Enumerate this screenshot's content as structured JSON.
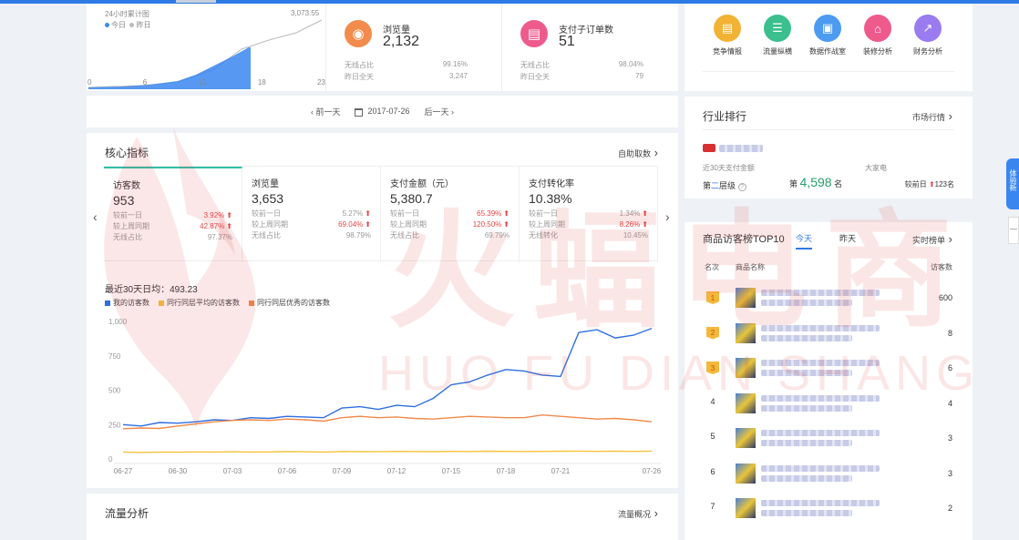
{
  "summary": {
    "mini_chart": {
      "title": "24小时累计图",
      "legend_today": "今日",
      "legend_yesterday": "昨日",
      "peak_label": "3,073.55",
      "x_ticks": [
        "0",
        "6",
        "12",
        "18",
        "23"
      ],
      "colors": {
        "today": "#3a86f0",
        "yesterday": "#bbbbbb"
      }
    },
    "views": {
      "title": "浏览量",
      "value": "2,132",
      "wireless_label": "无线占比",
      "wireless_value": "99.16%",
      "yday_label": "昨日全天",
      "yday_value": "3,247",
      "icon": "eye-icon",
      "color": "#f28b4b"
    },
    "orders": {
      "title": "支付子订单数",
      "value": "51",
      "wireless_label": "无线占比",
      "wireless_value": "98.04%",
      "yday_label": "昨日全天",
      "yday_value": "79",
      "icon": "clipboard-icon",
      "color": "#ef5a8c"
    }
  },
  "date_nav": {
    "prev": "‹ 前一天",
    "date": "2017-07-26",
    "next": "后一天 ›"
  },
  "core": {
    "title": "核心指标",
    "link": "自助取数",
    "tabs": [
      {
        "title": "访客数",
        "value": "953",
        "rows": [
          [
            "较前一日",
            "3.92%"
          ],
          [
            "较上周同期",
            "42.87%"
          ],
          [
            "无线占比",
            "97.37%"
          ]
        ],
        "up": [
          true,
          true,
          false
        ]
      },
      {
        "title": "浏览量",
        "value": "3,653",
        "rows": [
          [
            "较前一日",
            "5.27%"
          ],
          [
            "较上周同期",
            "69.04%"
          ],
          [
            "无线占比",
            "98.79%"
          ]
        ],
        "up": [
          true,
          true,
          false
        ]
      },
      {
        "title": "支付金额（元）",
        "value": "5,380.7",
        "rows": [
          [
            "较前一日",
            "65.39%"
          ],
          [
            "较上周同期",
            "120.50%"
          ],
          [
            "无线占比",
            "69.79%"
          ]
        ],
        "up": [
          true,
          true,
          false
        ]
      },
      {
        "title": "支付转化率",
        "value": "10.38%",
        "rows": [
          [
            "较前一日",
            "1.34%"
          ],
          [
            "较上周同期",
            "8.26%"
          ],
          [
            "无线转化",
            "10.45%"
          ]
        ],
        "up": [
          true,
          true,
          false
        ]
      }
    ],
    "avg_label": "最近30天日均：493.23"
  },
  "chart_data": {
    "type": "line",
    "x": [
      "06-27",
      "06-28",
      "06-29",
      "06-30",
      "07-01",
      "07-02",
      "07-03",
      "07-04",
      "07-05",
      "07-06",
      "07-07",
      "07-08",
      "07-09",
      "07-10",
      "07-11",
      "07-12",
      "07-13",
      "07-14",
      "07-15",
      "07-16",
      "07-17",
      "07-18",
      "07-19",
      "07-20",
      "07-21",
      "07-22",
      "07-23",
      "07-24",
      "07-25",
      "07-26"
    ],
    "x_ticks": [
      "06-27",
      "06-30",
      "07-03",
      "07-06",
      "07-09",
      "07-12",
      "07-15",
      "07-18",
      "07-21",
      "07-26"
    ],
    "y_ticks": [
      "0",
      "250",
      "500",
      "750",
      "1,000"
    ],
    "ylim": [
      0,
      1000
    ],
    "series": [
      {
        "name": "我的访客数",
        "color": "#2f6fe0",
        "values": [
          250,
          240,
          265,
          260,
          270,
          285,
          280,
          300,
          295,
          310,
          305,
          300,
          370,
          380,
          360,
          390,
          380,
          440,
          540,
          560,
          610,
          650,
          640,
          610,
          600,
          920,
          940,
          880,
          900,
          950
        ]
      },
      {
        "name": "同行同层平均的访客数",
        "color": "#f5c23c",
        "values": [
          50,
          48,
          50,
          49,
          51,
          50,
          52,
          50,
          51,
          53,
          52,
          50,
          54,
          53,
          52,
          55,
          54,
          53,
          55,
          54,
          56,
          55,
          54,
          55,
          56,
          57,
          55,
          56,
          55,
          57
        ]
      },
      {
        "name": "同行同层优秀的访客数",
        "color": "#f08a4b",
        "values": [
          220,
          225,
          222,
          240,
          255,
          270,
          280,
          285,
          280,
          290,
          285,
          275,
          300,
          310,
          300,
          305,
          295,
          290,
          300,
          310,
          305,
          300,
          300,
          320,
          310,
          300,
          290,
          295,
          285,
          270
        ]
      }
    ],
    "legend": "top-left",
    "grid": false
  },
  "flow": {
    "title": "流量分析",
    "link": "流量概况"
  },
  "tools": [
    {
      "label": "竞争情报",
      "icon": "document-icon",
      "color": "#f2b233"
    },
    {
      "label": "流量纵横",
      "icon": "chart-icon",
      "color": "#3bbf8e"
    },
    {
      "label": "数据作战室",
      "icon": "screen-icon",
      "color": "#4c9bf0"
    },
    {
      "label": "装修分析",
      "icon": "store-icon",
      "color": "#ef5a8c"
    },
    {
      "label": "财务分析",
      "icon": "trend-icon",
      "color": "#9a7bf0"
    }
  ],
  "rank": {
    "title": "行业排行",
    "link": "市场行情",
    "subtitle": "近30天支付金额",
    "industry": "大家电",
    "tier_prefix": "第",
    "tier": "二",
    "tier_suffix": "层级",
    "rank_prefix": "第",
    "rank_value": "4,598",
    "rank_suffix": "名",
    "change_label": "较前日",
    "change_value": "123名"
  },
  "top10": {
    "title": "商品访客榜TOP10",
    "tab_today": "今天",
    "tab_yesterday": "昨天",
    "link": "实时榜单",
    "col_rank": "名次",
    "col_name": "商品名称",
    "col_count": "访客数",
    "rows": [
      {
        "rank": "1",
        "count": "600"
      },
      {
        "rank": "2",
        "count": "8"
      },
      {
        "rank": "3",
        "count": "6"
      },
      {
        "rank": "4",
        "count": "4"
      },
      {
        "rank": "5",
        "count": "3"
      },
      {
        "rank": "6",
        "count": "3"
      },
      {
        "rank": "7",
        "count": "2"
      }
    ]
  },
  "watermark": {
    "cn": "火蝠电商",
    "en": "HUO FU DIAN SHANG"
  },
  "side_float": {
    "text": "体验新"
  }
}
